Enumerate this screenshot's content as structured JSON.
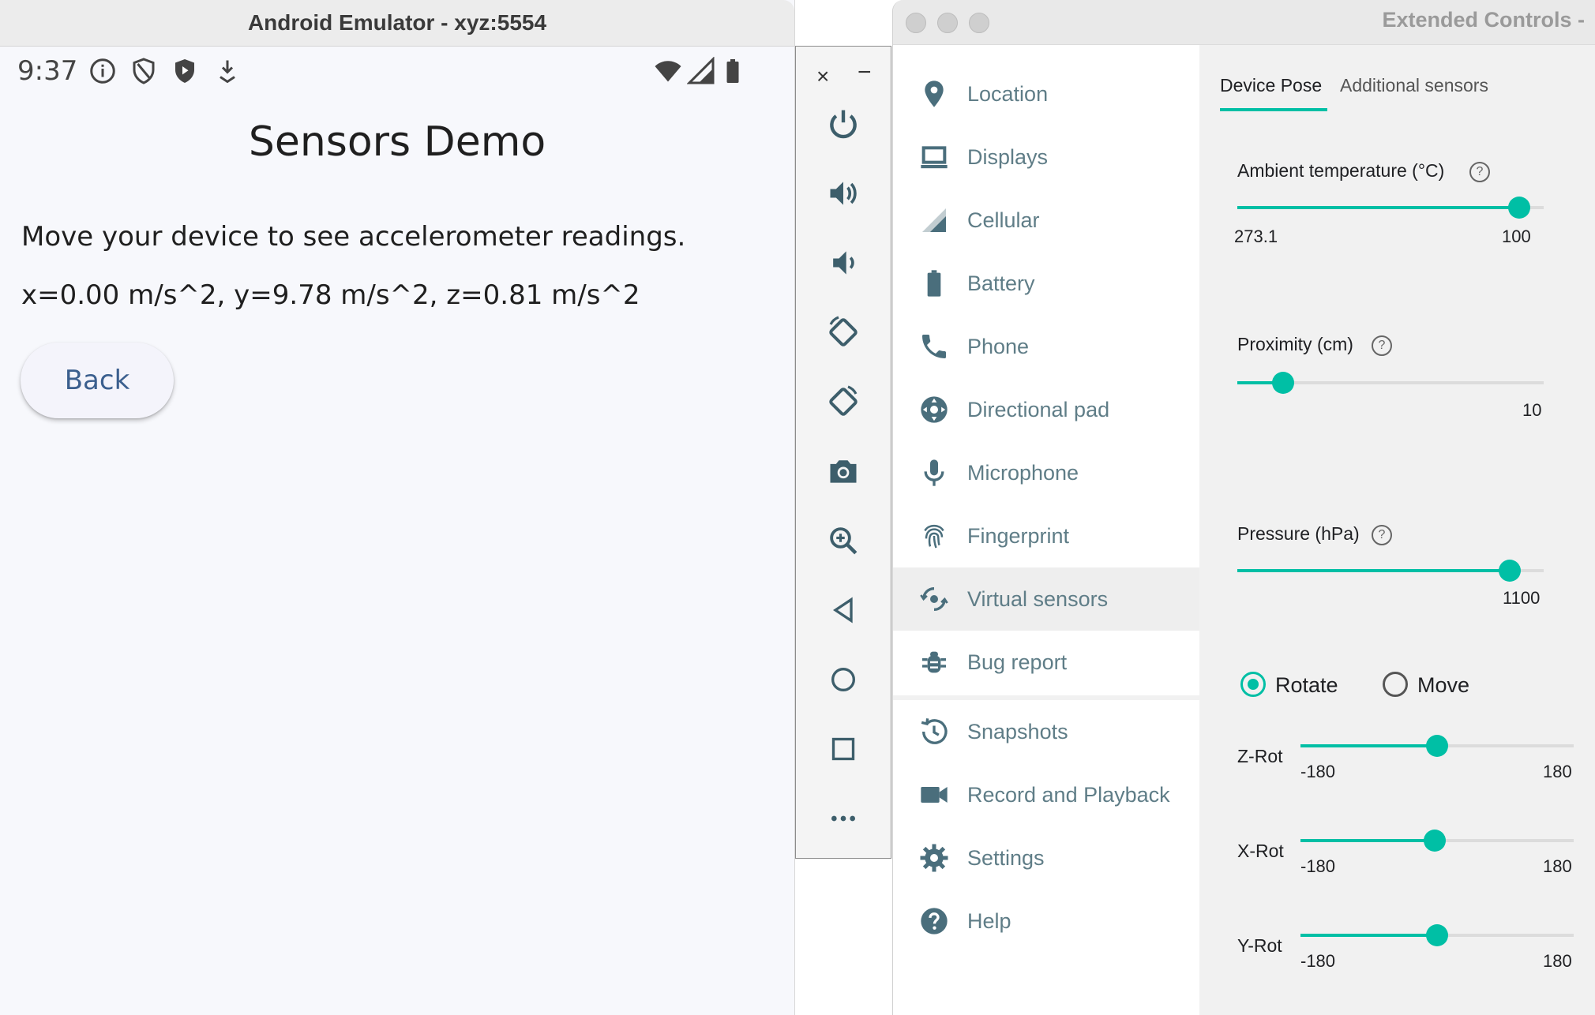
{
  "emulator": {
    "title": "Android Emulator - xyz:5554",
    "status_time": "9:37",
    "app_title": "Sensors Demo",
    "instruction": "Move your device to see accelerometer readings.",
    "reading": "x=0.00 m/s^2, y=9.78 m/s^2, z=0.81 m/s^2",
    "back_label": "Back"
  },
  "toolbar": {
    "close": "×",
    "minimize": "−",
    "buttons": [
      "power-icon",
      "volume-up-icon",
      "volume-down-icon",
      "rotate-left-icon",
      "rotate-right-icon",
      "camera-icon",
      "zoom-icon",
      "back-triangle-icon",
      "home-circle-icon",
      "overview-square-icon",
      "more-icon"
    ]
  },
  "extended": {
    "title": "Extended Controls -",
    "nav": [
      {
        "label": "Location",
        "icon": "location-pin-icon"
      },
      {
        "label": "Displays",
        "icon": "display-icon"
      },
      {
        "label": "Cellular",
        "icon": "cellular-icon"
      },
      {
        "label": "Battery",
        "icon": "battery-icon"
      },
      {
        "label": "Phone",
        "icon": "phone-icon"
      },
      {
        "label": "Directional pad",
        "icon": "dpad-icon"
      },
      {
        "label": "Microphone",
        "icon": "microphone-icon"
      },
      {
        "label": "Fingerprint",
        "icon": "fingerprint-icon"
      },
      {
        "label": "Virtual sensors",
        "icon": "virtual-sensors-icon",
        "selected": true
      },
      {
        "label": "Bug report",
        "icon": "bug-icon"
      },
      {
        "label": "Snapshots",
        "icon": "history-icon"
      },
      {
        "label": "Record and Playback",
        "icon": "videocam-icon"
      },
      {
        "label": "Settings",
        "icon": "gear-icon"
      },
      {
        "label": "Help",
        "icon": "help-icon"
      }
    ],
    "tabs": {
      "device_pose": "Device Pose",
      "additional": "Additional sensors"
    },
    "sensors": {
      "ambient": {
        "label": "Ambient temperature (°C)",
        "min_text": "273.1",
        "max_text": "100",
        "fraction": 0.92
      },
      "proximity": {
        "label": "Proximity (cm)",
        "max_text": "10",
        "fraction": 0.15
      },
      "pressure": {
        "label": "Pressure (hPa)",
        "max_text": "1100",
        "fraction": 0.89
      }
    },
    "mode": {
      "rotate": "Rotate",
      "move": "Move",
      "selected": "rotate"
    },
    "rotations": [
      {
        "label": "Z-Rot",
        "min": "-180",
        "max": "180",
        "fraction": 0.5
      },
      {
        "label": "X-Rot",
        "min": "-180",
        "max": "180",
        "fraction": 0.49
      },
      {
        "label": "Y-Rot",
        "min": "-180",
        "max": "180",
        "fraction": 0.5
      }
    ]
  }
}
